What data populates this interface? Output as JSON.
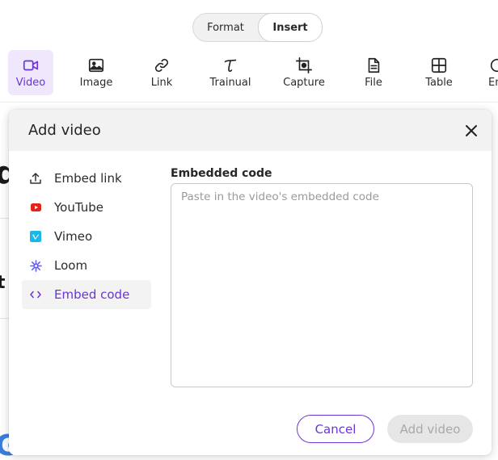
{
  "tabs": [
    {
      "label": "Format"
    },
    {
      "label": "Insert"
    }
  ],
  "toolbar": {
    "items": [
      {
        "label": "Video",
        "icon": "video-icon"
      },
      {
        "label": "Image",
        "icon": "image-icon"
      },
      {
        "label": "Link",
        "icon": "link-icon"
      },
      {
        "label": "Trainual",
        "icon": "trainual-icon"
      },
      {
        "label": "Capture",
        "icon": "capture-icon"
      },
      {
        "label": "File",
        "icon": "file-icon"
      },
      {
        "label": "Table",
        "icon": "table-icon"
      },
      {
        "label": "Em",
        "icon": "embed-icon"
      }
    ]
  },
  "modal": {
    "title": "Add video",
    "sources": [
      {
        "label": "Embed link",
        "icon": "upload-icon"
      },
      {
        "label": "YouTube",
        "icon": "youtube-icon"
      },
      {
        "label": "Vimeo",
        "icon": "vimeo-icon"
      },
      {
        "label": "Loom",
        "icon": "loom-icon"
      },
      {
        "label": "Embed code",
        "icon": "code-icon"
      }
    ],
    "field_label": "Embedded code",
    "field_placeholder": "Paste in the video's embedded code",
    "cancel_label": "Cancel",
    "submit_label": "Add video"
  },
  "background": {
    "fragment_1": "d",
    "fragment_2": "t",
    "fragment_3": "G"
  },
  "colors": {
    "accent": "#6b34d6",
    "accent_bg": "#efe8fc",
    "youtube": "#e62117",
    "vimeo": "#19b7ea",
    "loom": "#625df5"
  }
}
